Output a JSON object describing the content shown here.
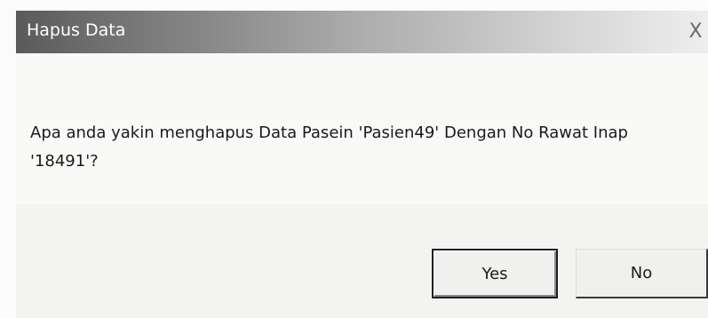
{
  "dialog": {
    "title": "Hapus Data",
    "close_glyph": "X",
    "message": "Apa anda yakin menghapus Data Pasein 'Pasien49' Dengan No Rawat Inap '18491'?",
    "buttons": {
      "yes_label": "Yes",
      "no_label": "No"
    }
  },
  "colors": {
    "title_gradient_start": "#5a5a5a",
    "title_gradient_end": "#eeeeee",
    "dialog_background": "#f9f9f8"
  }
}
